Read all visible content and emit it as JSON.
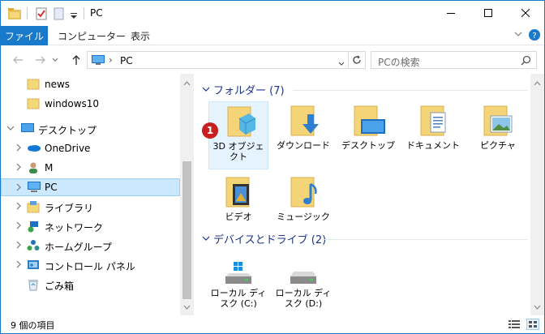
{
  "window": {
    "title": "PC",
    "minimize_glyph": "—",
    "maximize_glyph": "☐",
    "close_glyph": "✕"
  },
  "ribbon": {
    "file_tab": "ファイル",
    "tabs": [
      "コンピューター",
      "表示"
    ],
    "accent": "#1979ca"
  },
  "address": {
    "path": "PC",
    "search_placeholder": "PCの検索"
  },
  "nav": {
    "items": [
      {
        "label": "news"
      },
      {
        "label": "windows10"
      },
      {
        "label": "デスクトップ"
      },
      {
        "label": "OneDrive"
      },
      {
        "label": "M"
      },
      {
        "label": "PC"
      },
      {
        "label": "ライブラリ"
      },
      {
        "label": "ネットワーク"
      },
      {
        "label": "ホームグループ"
      },
      {
        "label": "コントロール パネル"
      },
      {
        "label": "ごみ箱"
      }
    ]
  },
  "content": {
    "folders_header": "フォルダー (7)",
    "folders": [
      {
        "label": "3D オブジェクト",
        "icon": "3d-objects-icon"
      },
      {
        "label": "ダウンロード",
        "icon": "downloads-icon"
      },
      {
        "label": "デスクトップ",
        "icon": "desktop-icon"
      },
      {
        "label": "ドキュメント",
        "icon": "documents-icon"
      },
      {
        "label": "ピクチャ",
        "icon": "pictures-icon"
      },
      {
        "label": "ビデオ",
        "icon": "videos-icon"
      },
      {
        "label": "ミュージック",
        "icon": "music-icon"
      }
    ],
    "devices_header": "デバイスとドライブ (2)",
    "devices": [
      {
        "label": "ローカル ディスク (C:)",
        "icon": "windows-drive-icon"
      },
      {
        "label": "ローカル ディスク (D:)",
        "icon": "drive-icon"
      }
    ],
    "badge": "1"
  },
  "status": {
    "item_count": "9 個の項目"
  }
}
